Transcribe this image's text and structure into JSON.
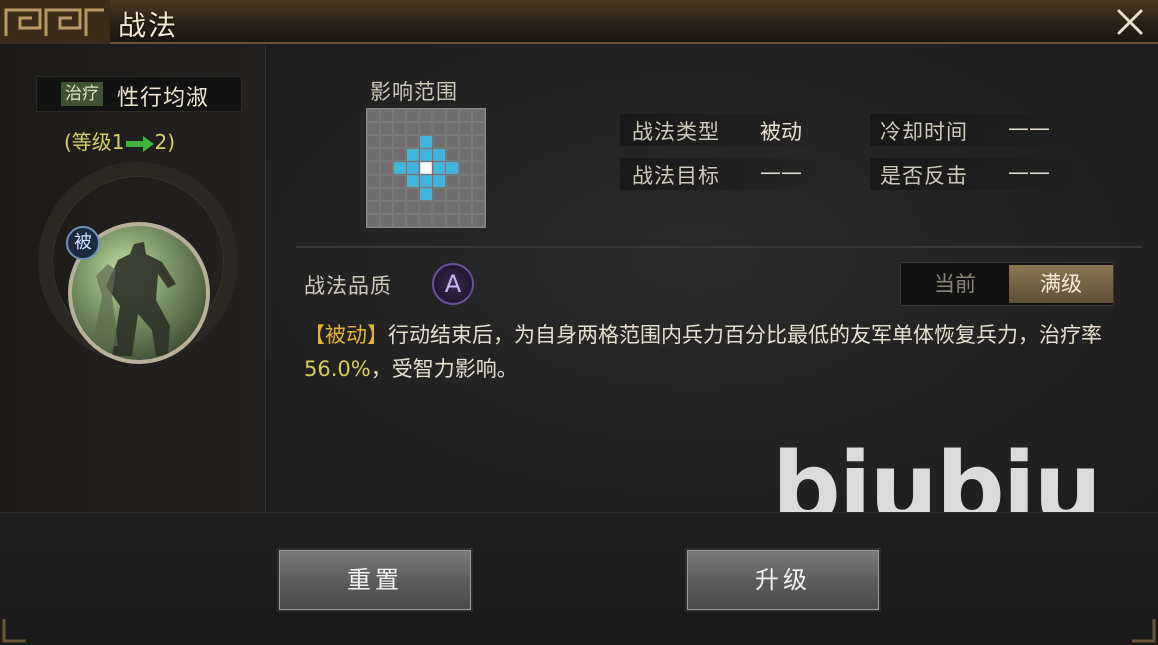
{
  "window": {
    "title": "战法",
    "close_icon": "close-icon"
  },
  "skill": {
    "tag": "治疗",
    "name": "性行均淑",
    "level_prefix": "(等级1",
    "level_suffix": "2)",
    "type_badge": "被"
  },
  "range": {
    "label": "影响范围",
    "grid_size": 9,
    "center": [
      4,
      4
    ],
    "highlighted_cells": [
      [
        4,
        2
      ],
      [
        3,
        3
      ],
      [
        4,
        3
      ],
      [
        5,
        3
      ],
      [
        2,
        4
      ],
      [
        3,
        4
      ],
      [
        5,
        4
      ],
      [
        6,
        4
      ],
      [
        3,
        5
      ],
      [
        4,
        5
      ],
      [
        5,
        5
      ],
      [
        4,
        6
      ]
    ]
  },
  "info": {
    "type_label": "战法类型",
    "type_value": "被动",
    "cooldown_label": "冷却时间",
    "cooldown_value": "——",
    "target_label": "战法目标",
    "target_value": "——",
    "counter_label": "是否反击",
    "counter_value": "——"
  },
  "quality": {
    "label": "战法品质",
    "grade": "A"
  },
  "toggle": {
    "current": "当前",
    "max": "满级",
    "selected": "max"
  },
  "description": {
    "tag": "【被动】",
    "text_1": "行动结束后，为自身两格范围内兵力百分比最低的友军单体恢复兵力，治疗率",
    "rate": "56.0%",
    "text_2": "，受智力影响。"
  },
  "watermark": "biubiu",
  "buttons": {
    "reset": "重置",
    "upgrade": "升级"
  },
  "colors": {
    "title_bar": "#2b2116",
    "highlight_cell": "#3fb4dc",
    "center_cell": "#ffffff",
    "grid_cell": "#6e6e6e",
    "level_color": "#d8cf66",
    "arrow_color": "#3fb33f",
    "tag_color": "#e3b43c",
    "rate_color": "#d5cd5a",
    "quality_color": "#6a4f9a"
  }
}
